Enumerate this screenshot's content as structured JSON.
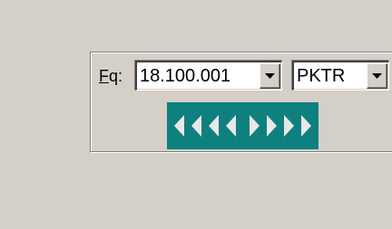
{
  "frequency": {
    "label": "Fq:",
    "mnemonic": "F",
    "label_rest": "q:",
    "value": "18.100.001"
  },
  "mode": {
    "value": "PKTR"
  },
  "nav": {
    "arrows": [
      "step-left-4",
      "step-left-3",
      "step-left-2",
      "step-left-1",
      "step-right-1",
      "step-right-2",
      "step-right-3",
      "step-right-4"
    ],
    "background_color": "#0f8080",
    "arrow_color": "#e8e8e8"
  }
}
